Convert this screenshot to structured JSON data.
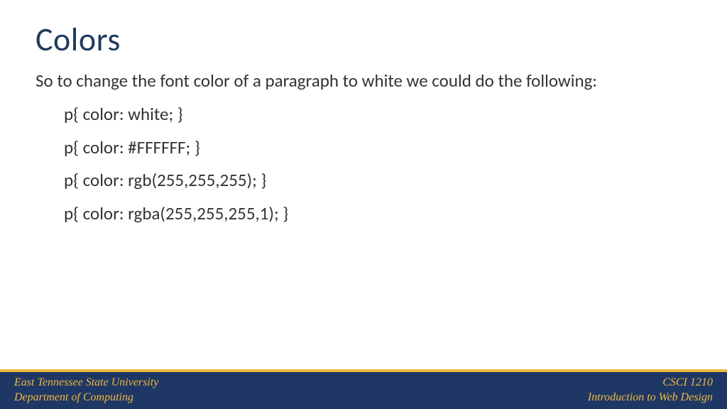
{
  "slide": {
    "title": "Colors",
    "intro": "So to change the font color of a paragraph to white we could do the following:",
    "code_lines": [
      "p{ color: white; }",
      "p{ color: #FFFFFF; }",
      "p{ color: rgb(255,255,255); }",
      "p{ color: rgba(255,255,255,1); }"
    ]
  },
  "footer": {
    "left_line1": "East Tennessee State University",
    "left_line2": "Department of Computing",
    "right_line1": "CSCI 1210",
    "right_line2": "Introduction to Web Design"
  }
}
